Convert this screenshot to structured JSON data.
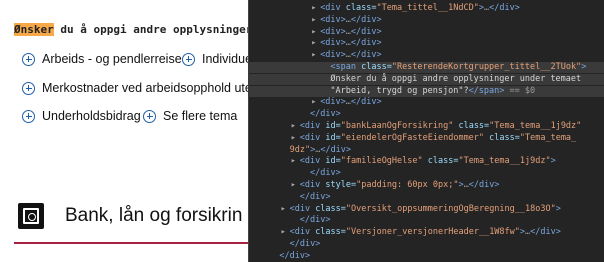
{
  "page": {
    "question_highlight": "Ønsker",
    "question_rest": " du å oppgi andre opplysninger und",
    "topics": [
      {
        "label": "Arbeids - og pendlerreise"
      },
      {
        "label": "Individue"
      },
      {
        "label": "Merkostnader ved arbeidsopphold utenfo"
      },
      {
        "label": "Underholdsbidrag"
      },
      {
        "label": "Se flere tema"
      }
    ],
    "section_title": "Bank, lån og forsikrin",
    "section_icon": "safe-icon",
    "accent_color": "#a8213f"
  },
  "devtools": {
    "lines": [
      {
        "indent": 12,
        "parts": [
          {
            "t": "tag",
            "v": "<div "
          },
          {
            "t": "attr",
            "v": "class="
          },
          {
            "t": "val",
            "v": "\"Tema_tittel__1NdCD\""
          },
          {
            "t": "tag",
            "v": ">"
          },
          {
            "t": "dim",
            "v": "…"
          },
          {
            "t": "tag",
            "v": "</div>"
          }
        ]
      },
      {
        "indent": 12,
        "parts": [
          {
            "t": "tag",
            "v": "<div>"
          },
          {
            "t": "dim",
            "v": "…"
          },
          {
            "t": "tag",
            "v": "</div>"
          }
        ]
      },
      {
        "indent": 12,
        "parts": [
          {
            "t": "tag",
            "v": "<div>"
          },
          {
            "t": "dim",
            "v": "…"
          },
          {
            "t": "tag",
            "v": "</div>"
          }
        ]
      },
      {
        "indent": 12,
        "parts": [
          {
            "t": "tag",
            "v": "<div>"
          },
          {
            "t": "dim",
            "v": "…"
          },
          {
            "t": "tag",
            "v": "</div>"
          }
        ]
      },
      {
        "indent": 12,
        "parts": [
          {
            "t": "tag",
            "v": "<div>"
          },
          {
            "t": "dim",
            "v": "…"
          },
          {
            "t": "tag",
            "v": "</div>"
          }
        ]
      },
      {
        "indent": 14,
        "selected": true,
        "parts": [
          {
            "t": "tag",
            "v": "<span "
          },
          {
            "t": "attr",
            "v": "class="
          },
          {
            "t": "val",
            "v": "\"ResterendeKortgrupper_tittel__2TUok\""
          },
          {
            "t": "tag",
            "v": ">"
          }
        ]
      },
      {
        "indent": 14,
        "selected": true,
        "parts": [
          {
            "t": "txt",
            "v": "Ønsker du å oppgi andre opplysninger under temaet"
          }
        ]
      },
      {
        "indent": 14,
        "selected": true,
        "parts": [
          {
            "t": "txt",
            "v": "\"Arbeid, trygd og pensjon\"?"
          },
          {
            "t": "tag",
            "v": "</span>"
          },
          {
            "t": "dim",
            "v": " == $0"
          }
        ]
      },
      {
        "indent": 12,
        "parts": [
          {
            "t": "tag",
            "v": "<div>"
          },
          {
            "t": "dim",
            "v": "…"
          },
          {
            "t": "tag",
            "v": "</div>"
          }
        ]
      },
      {
        "indent": 10,
        "parts": [
          {
            "t": "tag",
            "v": "</div>"
          }
        ]
      },
      {
        "indent": 8,
        "parts": [
          {
            "t": "tag",
            "v": "<div "
          },
          {
            "t": "attr",
            "v": "id="
          },
          {
            "t": "val",
            "v": "\"bankLaanOgForsikring\""
          },
          {
            "t": "attr",
            "v": " class="
          },
          {
            "t": "val",
            "v": "\"Tema_tema__1j9dz\""
          }
        ]
      },
      {
        "indent": 8,
        "parts": [
          {
            "t": "tag",
            "v": "<div "
          },
          {
            "t": "attr",
            "v": "id="
          },
          {
            "t": "val",
            "v": "\"eiendelerOgFasteEiendommer\""
          },
          {
            "t": "attr",
            "v": " class="
          },
          {
            "t": "val",
            "v": "\"Tema_tema_"
          }
        ]
      },
      {
        "indent": 6,
        "parts": [
          {
            "t": "val",
            "v": "9dz\""
          },
          {
            "t": "tag",
            "v": ">"
          },
          {
            "t": "dim",
            "v": "…"
          },
          {
            "t": "tag",
            "v": "</div>"
          }
        ]
      },
      {
        "indent": 8,
        "parts": [
          {
            "t": "tag",
            "v": "<div "
          },
          {
            "t": "attr",
            "v": "id="
          },
          {
            "t": "val",
            "v": "\"familieOgHelse\""
          },
          {
            "t": "attr",
            "v": " class="
          },
          {
            "t": "val",
            "v": "\"Tema_tema__1j9dz\""
          },
          {
            "t": "tag",
            "v": ">"
          }
        ]
      },
      {
        "indent": 10,
        "parts": [
          {
            "t": "tag",
            "v": "</div>"
          }
        ]
      },
      {
        "indent": 8,
        "parts": [
          {
            "t": "tag",
            "v": "<div "
          },
          {
            "t": "attr",
            "v": "style="
          },
          {
            "t": "val",
            "v": "\"padding: 60px 0px;\""
          },
          {
            "t": "tag",
            "v": ">"
          },
          {
            "t": "dim",
            "v": "…"
          },
          {
            "t": "tag",
            "v": "</div>"
          }
        ]
      },
      {
        "indent": 8,
        "parts": [
          {
            "t": "tag",
            "v": "</div>"
          }
        ]
      },
      {
        "indent": 6,
        "parts": [
          {
            "t": "tag",
            "v": "<div "
          },
          {
            "t": "attr",
            "v": "class="
          },
          {
            "t": "val",
            "v": "\"Oversikt_oppsummeringOgBeregning__18o3O\""
          },
          {
            "t": "tag",
            "v": ">"
          }
        ]
      },
      {
        "indent": 8,
        "parts": [
          {
            "t": "tag",
            "v": "</div>"
          }
        ]
      },
      {
        "indent": 6,
        "parts": [
          {
            "t": "tag",
            "v": "<div "
          },
          {
            "t": "attr",
            "v": "class="
          },
          {
            "t": "val",
            "v": "\"Versjoner_versjonerHeader__1W8fw\""
          },
          {
            "t": "tag",
            "v": ">"
          },
          {
            "t": "dim",
            "v": "…"
          },
          {
            "t": "tag",
            "v": "</div>"
          }
        ]
      },
      {
        "indent": 6,
        "parts": [
          {
            "t": "tag",
            "v": "</div>"
          }
        ]
      },
      {
        "indent": 4,
        "parts": [
          {
            "t": "tag",
            "v": "</div>"
          }
        ]
      }
    ]
  }
}
